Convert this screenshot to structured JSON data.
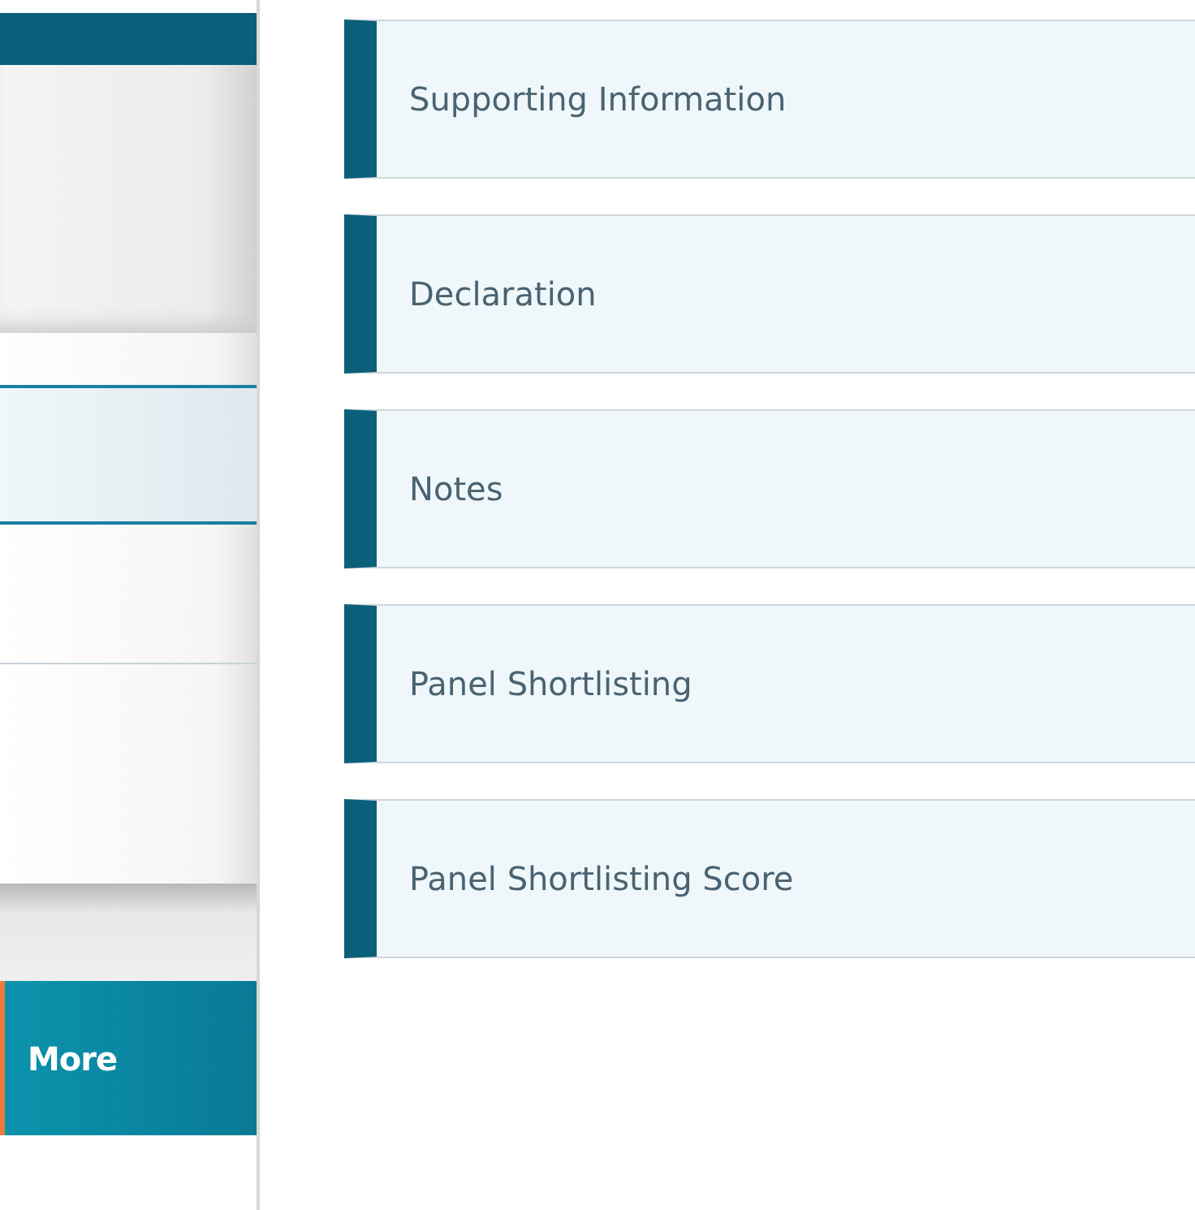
{
  "sidebar": {
    "rows": [
      {
        "selected": false
      },
      {
        "selected": true
      },
      {
        "selected": false
      },
      {
        "selected": false
      }
    ],
    "more_button": "More"
  },
  "sections": [
    {
      "title": "Supporting Information"
    },
    {
      "title": "Declaration"
    },
    {
      "title": "Notes"
    },
    {
      "title": "Panel Shortlisting"
    },
    {
      "title": "Panel Shortlisting Score"
    }
  ]
}
